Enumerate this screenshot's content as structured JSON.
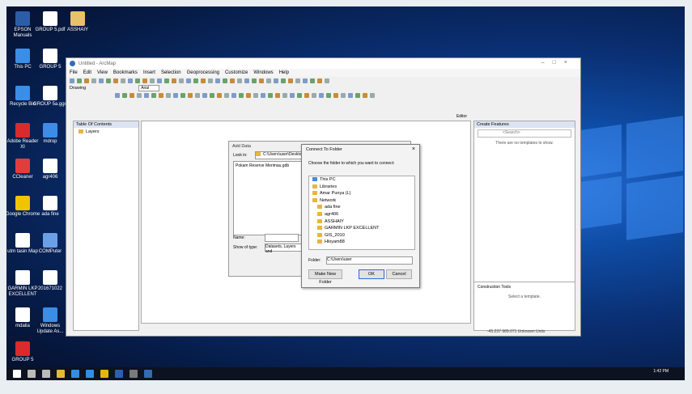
{
  "desktop": {
    "icons": [
      {
        "label": "EPSON Manuals",
        "color": "#2c5ea8"
      },
      {
        "label": "GROUP 5.pdf",
        "color": "#ffffff"
      },
      {
        "label": "ASSHAIY",
        "color": "#e8c16a"
      },
      {
        "label": "This PC",
        "color": "#3a8ee6"
      },
      {
        "label": "GROUP 5",
        "color": "#ffffff"
      },
      {
        "label": "Recycle Bin",
        "color": "#3a8ee6"
      },
      {
        "label": "GROUP 5a.ggo",
        "color": "#ffffff"
      },
      {
        "label": "Adobe Reader XI",
        "color": "#d92b2b"
      },
      {
        "label": "mdrop",
        "color": "#3a8ee6"
      },
      {
        "label": "CCleaner",
        "color": "#e23d3d"
      },
      {
        "label": "agr406",
        "color": "#ffffff"
      },
      {
        "label": "Google Chrome",
        "color": "#f1c400"
      },
      {
        "label": "ada fine",
        "color": "#ffffff"
      },
      {
        "label": "utm tasin Map",
        "color": "#ffffff"
      },
      {
        "label": "COMPuter",
        "color": "#6aa0e8"
      },
      {
        "label": "GARMIN LKP EXCELLENT",
        "color": "#ffffff"
      },
      {
        "label": "201671022",
        "color": "#ffffff"
      },
      {
        "label": "mdalia",
        "color": "#ffffff"
      },
      {
        "label": "Windows Update As...",
        "color": "#3a8ee6"
      },
      {
        "label": "GROUP 5",
        "color": "#d92b2b"
      }
    ]
  },
  "taskbar": {
    "time": "1:42 PM",
    "icons": [
      "start-icon",
      "search-icon",
      "task-view-icon",
      "explorer-icon",
      "edge-icon",
      "store-icon",
      "chrome-icon",
      "word-icon",
      "photos-icon",
      "arcmap-icon"
    ]
  },
  "arcmap": {
    "title": "Untitled - ArcMap",
    "menu": [
      "File",
      "Edit",
      "View",
      "Bookmarks",
      "Insert",
      "Selection",
      "Geoprocessing",
      "Customize",
      "Windows",
      "Help"
    ],
    "toc_title": "Table Of Contents",
    "toc_layers": "Layers",
    "drawing_label": "Drawing",
    "font_value": "Arial",
    "create_features_title": "Create Features",
    "create_search_placeholder": "<Search>",
    "no_templates": "There are no templates to show.",
    "construction_tools": "Construction Tools",
    "select_template": "Select a template.",
    "coords": "-45.237  989.071 Unknown Units",
    "editor_label": "Editor"
  },
  "adddata": {
    "title": "Add Data",
    "look_in_label": "Look in:",
    "look_in_value": "C:\\Users\\user\\Desktop",
    "file_item": "Pokam Reserve Merimau.gdb",
    "name_label": "Name:",
    "type_label": "Show of type:",
    "type_value": "Datasets, Layers and"
  },
  "connect": {
    "title": "Connect To Folder",
    "close": "×",
    "prompt": "Choose the folder to which you want to connect:",
    "tree": [
      "This PC",
      "Libraries",
      "Amar Punya (L)",
      "Network",
      "ada fine",
      "agr406",
      "ASSHAIY",
      "GARMIN LKP EXCELLENT",
      "GIS_2010",
      "Hloyam88"
    ],
    "folder_label": "Folder:",
    "folder_value": "C:\\Users\\user",
    "make_new": "Make New Folder",
    "ok": "OK",
    "cancel": "Cancel"
  }
}
